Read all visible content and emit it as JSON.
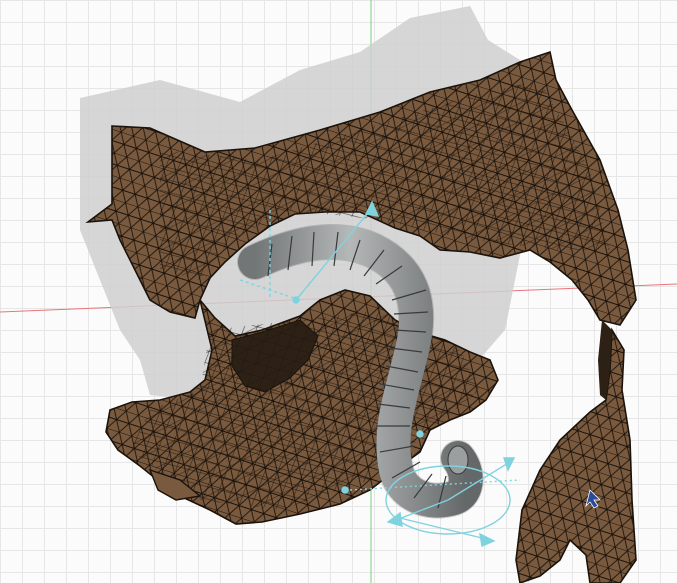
{
  "viewport": {
    "axis_colors": {
      "x": "#e8757a",
      "y": "#7bd27b"
    },
    "grid_color": "#e6e6e6",
    "background": "#fbfbfb"
  },
  "model": {
    "surface_color": "#7a5a3e",
    "wire_color": "#1a120b",
    "shadow_color": "#cccccc"
  },
  "instrument": {
    "color": "#a7aaab",
    "ring_color": "#3a3a3a"
  },
  "gizmo": {
    "color": "#7fd3df",
    "icon": "move-gizmo-icon"
  },
  "cursor": {
    "color": "#2b4a9b",
    "icon": "cursor-arrow-icon"
  }
}
